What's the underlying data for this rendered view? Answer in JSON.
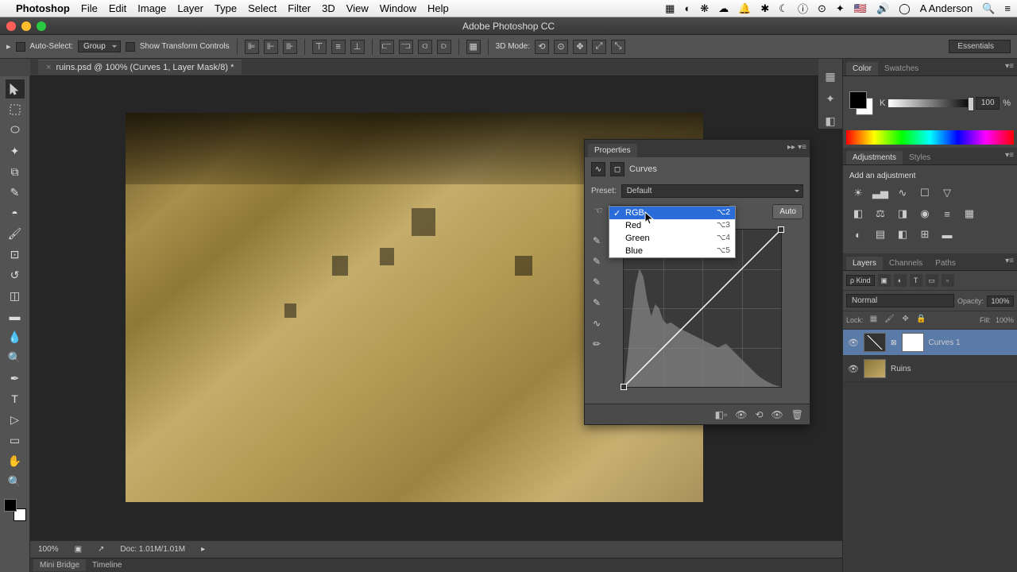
{
  "menubar": {
    "app": "Photoshop",
    "items": [
      "File",
      "Edit",
      "Image",
      "Layer",
      "Type",
      "Select",
      "Filter",
      "3D",
      "View",
      "Window",
      "Help"
    ],
    "user": "A Anderson"
  },
  "window_title": "Adobe Photoshop CC",
  "toolbar": {
    "auto_select": "Auto-Select:",
    "group": "Group",
    "show_tc": "Show Transform Controls",
    "mode3d": "3D Mode:",
    "workspace": "Essentials"
  },
  "doc_tab": "ruins.psd @ 100% (Curves 1, Layer Mask/8) *",
  "panels": {
    "color": {
      "tabs": [
        "Color",
        "Swatches"
      ],
      "k_label": "K",
      "k_value": "100",
      "k_unit": "%"
    },
    "adjustments": {
      "tabs": [
        "Adjustments",
        "Styles"
      ],
      "title": "Add an adjustment"
    },
    "layers": {
      "tabs": [
        "Layers",
        "Channels",
        "Paths"
      ],
      "kind": "ρ Kind",
      "blend": "Normal",
      "opacity_lbl": "Opacity:",
      "opacity": "100%",
      "lock_lbl": "Lock:",
      "fill_lbl": "Fill:",
      "fill": "100%",
      "items": [
        {
          "name": "Curves 1",
          "type": "curves"
        },
        {
          "name": "Ruins",
          "type": "image"
        }
      ]
    }
  },
  "properties": {
    "tab": "Properties",
    "title": "Curves",
    "preset_lbl": "Preset:",
    "preset_val": "Default",
    "auto": "Auto",
    "channel_options": [
      {
        "label": "RGB",
        "shortcut": "⌥2",
        "selected": true
      },
      {
        "label": "Red",
        "shortcut": "⌥3"
      },
      {
        "label": "Green",
        "shortcut": "⌥4"
      },
      {
        "label": "Blue",
        "shortcut": "⌥5"
      }
    ]
  },
  "status": {
    "zoom": "100%",
    "doc": "Doc: 1.01M/1.01M"
  },
  "bottom_tabs": [
    "Mini Bridge",
    "Timeline"
  ]
}
